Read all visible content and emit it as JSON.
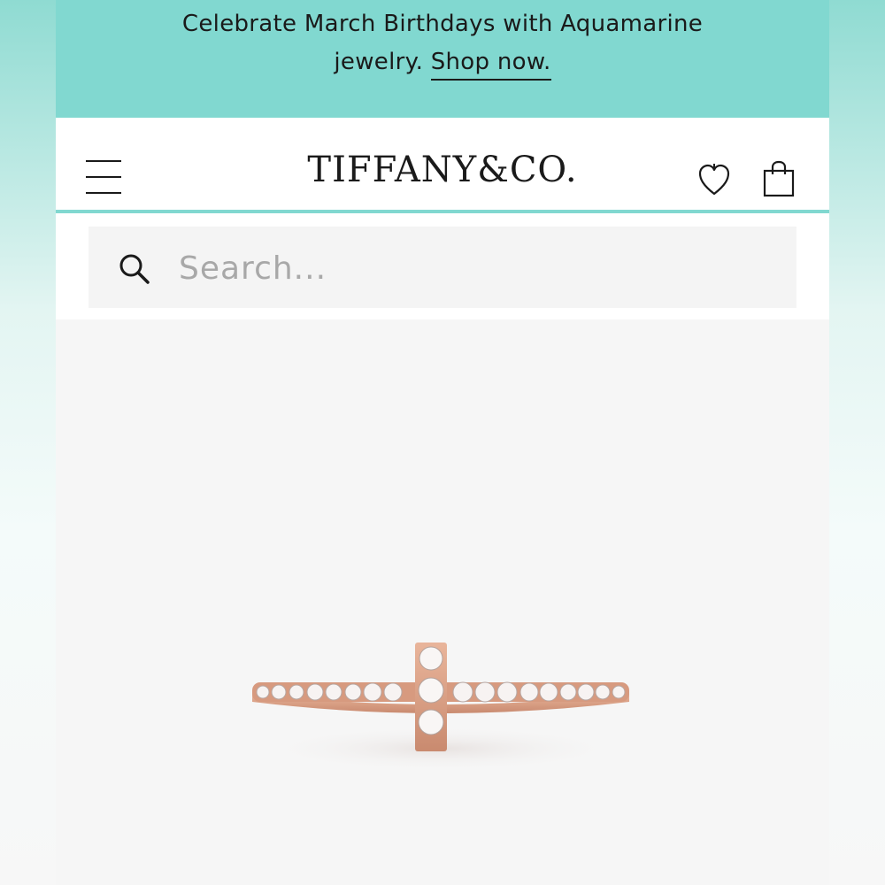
{
  "promo": {
    "line1": "Celebrate March Birthdays with Aquamarine",
    "line2_prefix": "jewelry. ",
    "link_label": "Shop now.",
    "background": "#81d8d0"
  },
  "header": {
    "logo": "TIFFANY&CO.",
    "menu_icon": "hamburger-menu-icon",
    "wishlist_icon": "heart-icon",
    "bag_icon": "shopping-bag-icon",
    "accent": "#81d8d0"
  },
  "search": {
    "placeholder": "Search...",
    "value": "",
    "icon": "search-icon"
  },
  "product": {
    "image_subject": "rose gold diamond T ring"
  }
}
